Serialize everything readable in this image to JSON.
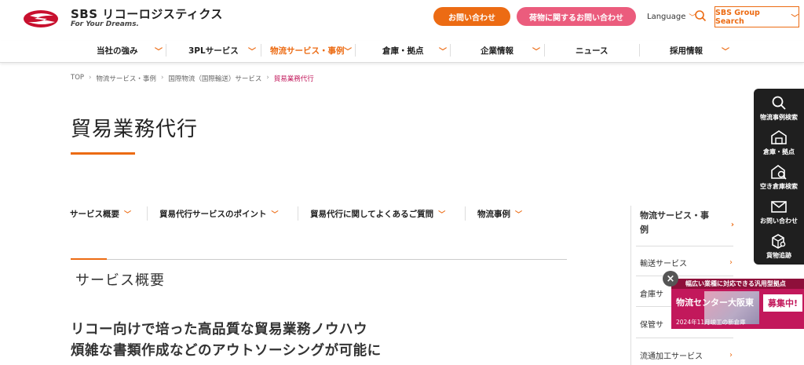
{
  "header": {
    "logo_name": "SBS リコーロジスティクス",
    "logo_tag": "For Your Dreams.",
    "contact_btn": "お問い合わせ",
    "cargo_btn": "荷物に関するお問い合わせ",
    "language": "Language",
    "group_search": "SBS Group Search",
    "brand_color": "#ec6b13",
    "pink_color": "#eb5c7d"
  },
  "nav": {
    "items": [
      {
        "label": "当社の強み"
      },
      {
        "label": "3PLサービス"
      },
      {
        "label": "物流サービス・事例"
      },
      {
        "label": "倉庫・拠点"
      },
      {
        "label": "企業情報"
      },
      {
        "label": "ニュース"
      },
      {
        "label": "採用情報"
      }
    ]
  },
  "breadcrumb": {
    "items": [
      "TOP",
      "物流サービス・事例",
      "国際物流（国際輸送）サービス",
      "貿易業務代行"
    ]
  },
  "page": {
    "title": "貿易業務代行",
    "tabs": [
      "サービス概要",
      "貿易代行サービスのポイント",
      "貿易代行に関してよくあるご質問",
      "物流事例"
    ],
    "section_title": "サービス概要",
    "lead_line1": "リコー向けで培った高品質な貿易業務ノウハウ",
    "lead_line2": "煩雑な書類作成などのアウトソーシングが可能に"
  },
  "side_menu": {
    "heading_line1": "物流サービス・事",
    "heading_line2": "例",
    "items": [
      "輸送サービス",
      "倉庫サ",
      "保管サ",
      "流通加工サービス"
    ]
  },
  "toolbar": {
    "items": [
      {
        "label": "物流事例検索",
        "icon": "search-icon"
      },
      {
        "label": "倉庫・拠点",
        "icon": "warehouse-icon"
      },
      {
        "label": "空き倉庫検索",
        "icon": "warehouse-search-icon"
      },
      {
        "label": "お問い合わせ",
        "icon": "mail-icon"
      },
      {
        "label": "貨物追跡",
        "icon": "package-search-icon"
      }
    ]
  },
  "banner": {
    "top_text": "幅広い業種に対応できる汎用型拠点",
    "main_text": "物流センター大阪東",
    "badge": "募集中!",
    "sub_text": "2024年11月竣工の新倉庫"
  }
}
